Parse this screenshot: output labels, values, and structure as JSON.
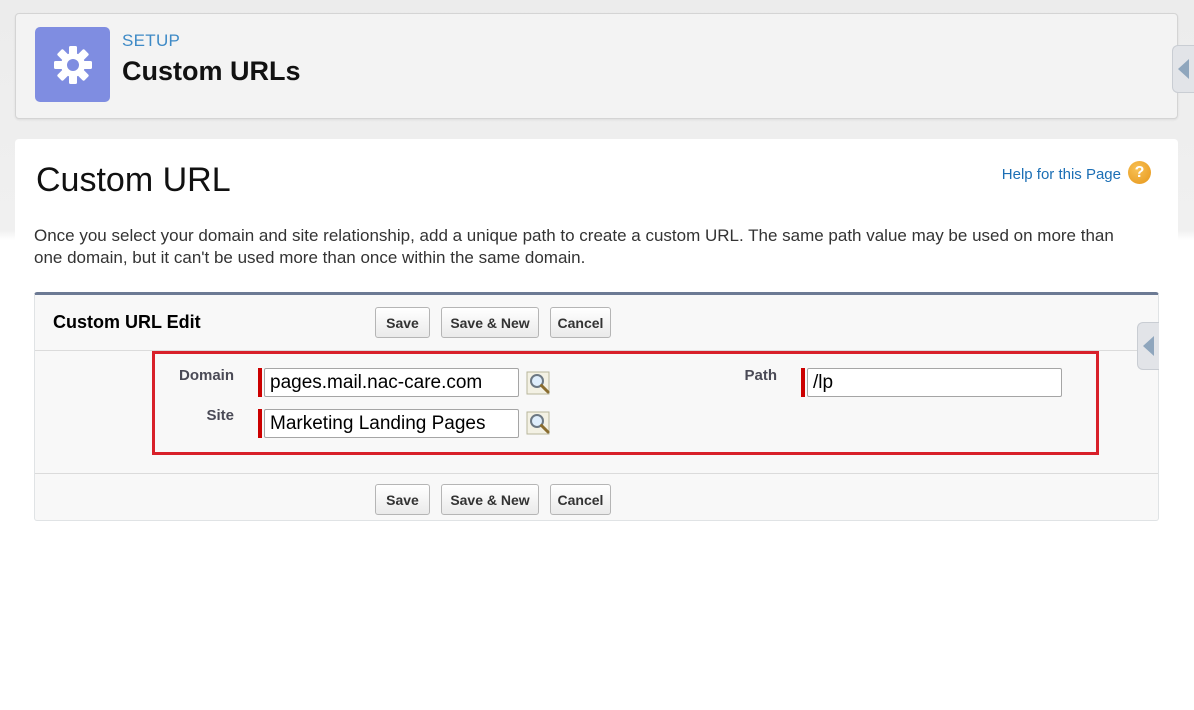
{
  "header": {
    "breadcrumb": "SETUP",
    "title": "Custom URLs"
  },
  "page": {
    "title": "Custom URL",
    "help_link": "Help for this Page",
    "help_icon": "?",
    "description": "Once you select your domain and site relationship, add a unique path to create a custom URL. The same path value may be used on more than one domain, but it can't be used more than once within the same domain."
  },
  "edit": {
    "title": "Custom URL Edit",
    "buttons": {
      "save": "Save",
      "save_new": "Save & New",
      "cancel": "Cancel"
    },
    "fields": {
      "domain_label": "Domain",
      "domain_value": "pages.mail.nac-care.com",
      "site_label": "Site",
      "site_value": "Marketing Landing Pages",
      "path_label": "Path",
      "path_value": "/lp"
    }
  },
  "icons": {
    "header": "gear-icon",
    "help": "help-icon",
    "lookup": "magnifier-icon",
    "side_tab": "collapse-tab-icon"
  },
  "colors": {
    "header_icon_bg": "#7f8de1",
    "required": "#cc0000",
    "highlight": "#d8202a",
    "link": "#1c6fb5"
  }
}
